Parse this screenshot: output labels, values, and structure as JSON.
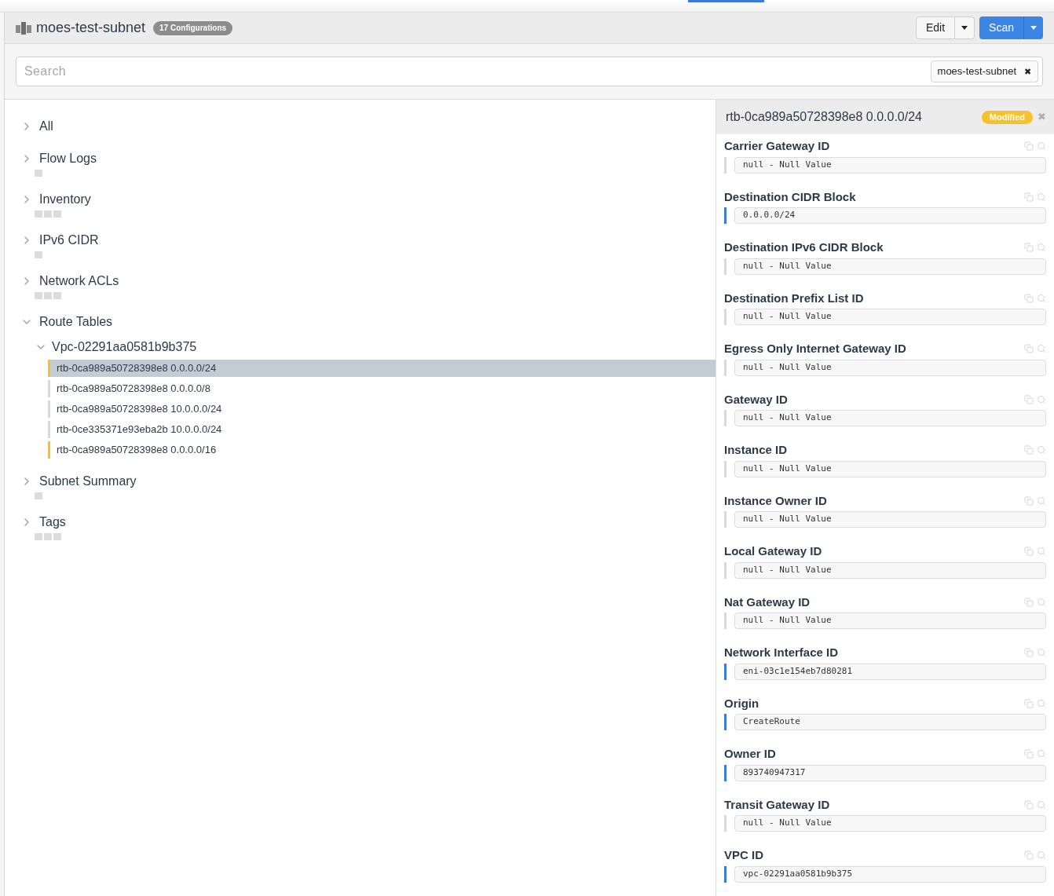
{
  "header": {
    "title": "moes-test-subnet",
    "badge": "17 Configurations",
    "edit_button": "Edit",
    "scan_button": "Scan"
  },
  "search": {
    "placeholder": "Search",
    "filter_chip": "moes-test-subnet",
    "filter_remove": "✖"
  },
  "tree": [
    {
      "label": "All",
      "expanded": false,
      "kind": "plain"
    },
    {
      "label": "Flow Logs",
      "expanded": false,
      "kind": "single"
    },
    {
      "label": "Inventory",
      "expanded": false,
      "kind": "triple"
    },
    {
      "label": "IPv6 CIDR",
      "expanded": false,
      "kind": "single"
    },
    {
      "label": "Network ACLs",
      "expanded": false,
      "kind": "triple"
    },
    {
      "label": "Route Tables",
      "expanded": true,
      "kind": "plain",
      "children": [
        {
          "label": "Vpc-02291aa0581b9b375",
          "expanded": true,
          "items": [
            {
              "label": "rtb-0ca989a50728398e8 0.0.0.0/24",
              "selected": true,
              "color": "#f5c12e"
            },
            {
              "label": "rtb-0ca989a50728398e8 0.0.0.0/8",
              "selected": false,
              "color": "#d9d9d9"
            },
            {
              "label": "rtb-0ca989a50728398e8 10.0.0.0/24",
              "selected": false,
              "color": "#d9d9d9"
            },
            {
              "label": "rtb-0ce335371e93eba2b 10.0.0.0/24",
              "selected": false,
              "color": "#d9d9d9"
            },
            {
              "label": "rtb-0ca989a50728398e8 0.0.0.0/16",
              "selected": false,
              "color": "#f5c12e"
            }
          ]
        }
      ]
    },
    {
      "label": "Subnet Summary",
      "expanded": false,
      "kind": "single"
    },
    {
      "label": "Tags",
      "expanded": false,
      "kind": "triple"
    }
  ],
  "detail": {
    "title": "rtb-0ca989a50728398e8 0.0.0.0/24",
    "status": "Modified",
    "close": "✖",
    "fields": [
      {
        "label": "Carrier Gateway ID",
        "value": "null - Null Value",
        "has_value": false
      },
      {
        "label": "Destination CIDR Block",
        "value": "0.0.0.0/24",
        "has_value": true
      },
      {
        "label": "Destination IPv6 CIDR Block",
        "value": "null - Null Value",
        "has_value": false
      },
      {
        "label": "Destination Prefix List ID",
        "value": "null - Null Value",
        "has_value": false
      },
      {
        "label": "Egress Only Internet Gateway ID",
        "value": "null - Null Value",
        "has_value": false
      },
      {
        "label": "Gateway ID",
        "value": "null - Null Value",
        "has_value": false
      },
      {
        "label": "Instance ID",
        "value": "null - Null Value",
        "has_value": false
      },
      {
        "label": "Instance Owner ID",
        "value": "null - Null Value",
        "has_value": false
      },
      {
        "label": "Local Gateway ID",
        "value": "null - Null Value",
        "has_value": false
      },
      {
        "label": "Nat Gateway ID",
        "value": "null - Null Value",
        "has_value": false
      },
      {
        "label": "Network Interface ID",
        "value": "eni-03c1e154eb7d80281",
        "has_value": true
      },
      {
        "label": "Origin",
        "value": "CreateRoute",
        "has_value": true
      },
      {
        "label": "Owner ID",
        "value": "893740947317",
        "has_value": true
      },
      {
        "label": "Transit Gateway ID",
        "value": "null - Null Value",
        "has_value": false
      },
      {
        "label": "VPC ID",
        "value": "vpc-02291aa0581b9b375",
        "has_value": true
      }
    ]
  }
}
